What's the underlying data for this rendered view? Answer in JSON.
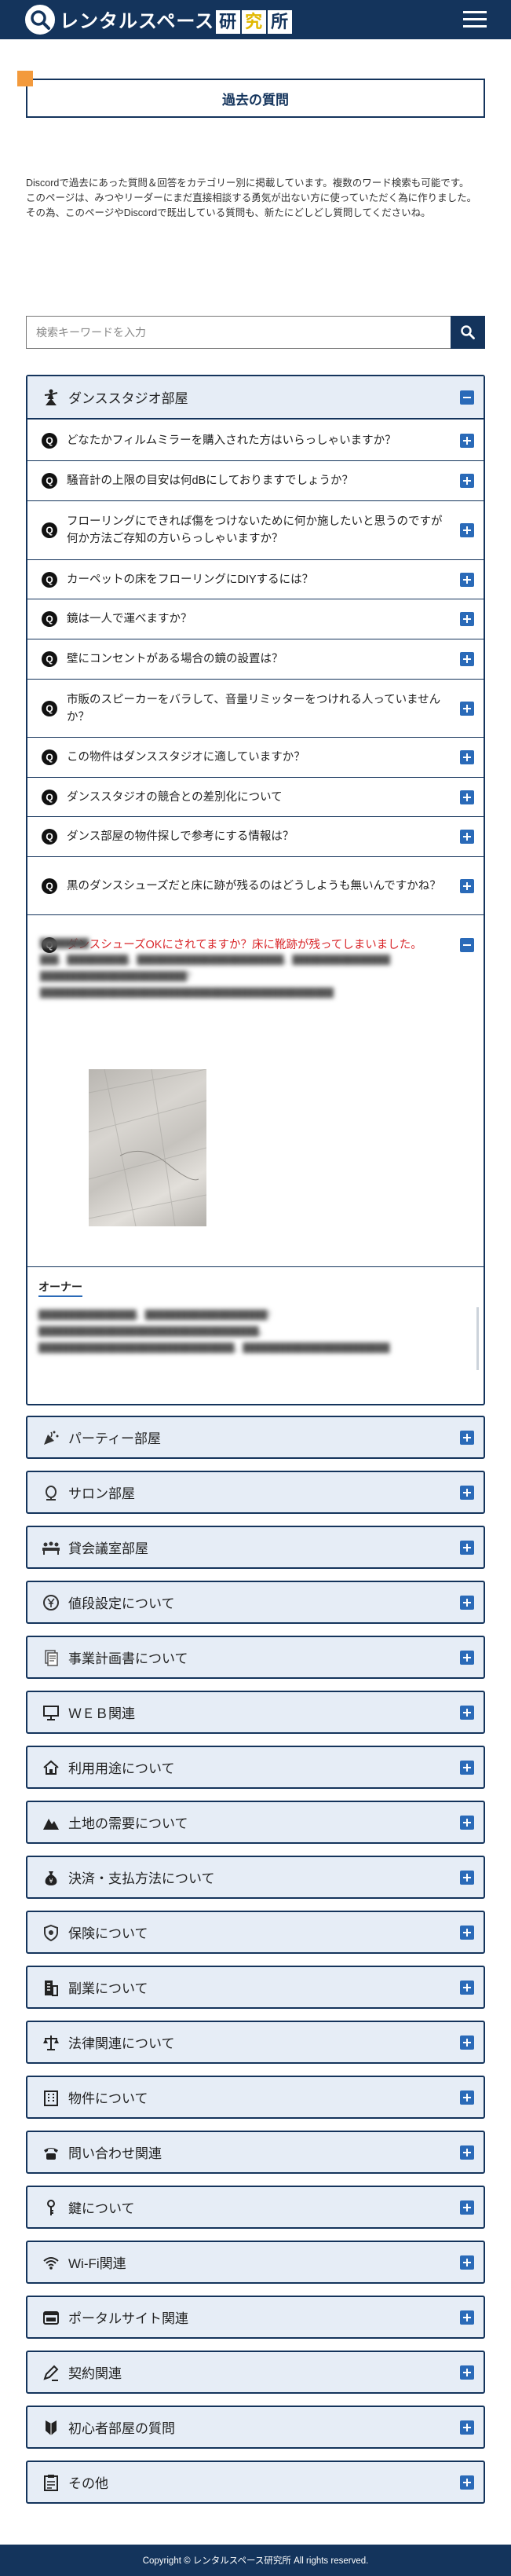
{
  "header": {
    "logo_text": "レンタルスペース",
    "logo_box_1": "研",
    "logo_box_2": "究",
    "logo_box_3": "所",
    "menu_icon": "hamburger-icon"
  },
  "page_title": "過去の質問",
  "intro_lines": [
    "Discordで過去にあった質問＆回答をカテゴリー別に掲載しています。複数のワード検索も可能です。",
    "このページは、みつやリーダーにまだ直接相談する勇気が出ない方に使っていただく為に作りました。",
    "その為、このページやDiscordで既出している質問も、新たにどしどし質問してくださいね。"
  ],
  "search": {
    "placeholder": "検索キーワードを入力",
    "icon": "search-icon"
  },
  "open_category": {
    "label": "ダンススタジオ部屋",
    "icon": "dancer-icon",
    "questions": [
      "どなたかフィルムミラーを購入された方はいらっしゃいますか？",
      "騒音計の上限の目安は何dBにしておりますでしょうか？",
      "フローリングにできれば傷をつけないために何か施したいと思うのですが何か方法ご存知の方いらっしゃいますか？",
      "カーペットの床をフローリングにDIYするには？",
      "鏡は一人で運べますか？",
      "壁にコンセントがある場合の鏡の設置は？",
      "市販のスピーカーをバラして、音量リミッターをつけれる人っていませんか？",
      "この物件はダンススタジオに適していますか？",
      "ダンススタジオの競合との差別化について",
      "ダンス部屋の物件探しで参考にする情報は？",
      "黒のダンスシューズだと床に跡が残るのはどうしようも無いんですかね？",
      "ダンスシューズOKにされてますか？床に靴跡が残ってしまいました。"
    ],
    "q_badge": "Q",
    "answer_owner_label": "オーナー"
  },
  "categories": [
    {
      "label": "パーティー部屋",
      "icon": "party-popper-icon"
    },
    {
      "label": "サロン部屋",
      "icon": "salon-mirror-icon"
    },
    {
      "label": "貸会議室部屋",
      "icon": "meeting-people-icon"
    },
    {
      "label": "値段設定について",
      "icon": "yen-coin-icon"
    },
    {
      "label": "事業計画書について",
      "icon": "document-icon"
    },
    {
      "label": "ＷＥＢ関連",
      "icon": "monitor-icon"
    },
    {
      "label": "利用用途について",
      "icon": "home-icon"
    },
    {
      "label": "土地の需要について",
      "icon": "mountain-icon"
    },
    {
      "label": "決済・支払方法について",
      "icon": "money-bag-icon"
    },
    {
      "label": "保険について",
      "icon": "shield-icon"
    },
    {
      "label": "副業について",
      "icon": "office-building-icon"
    },
    {
      "label": "法律関連について",
      "icon": "scales-icon"
    },
    {
      "label": "物件について",
      "icon": "building-icon"
    },
    {
      "label": "問い合わせ関連",
      "icon": "telephone-icon"
    },
    {
      "label": "鍵について",
      "icon": "key-icon"
    },
    {
      "label": "Wi-Fi関連",
      "icon": "wifi-icon"
    },
    {
      "label": "ポータルサイト関連",
      "icon": "browser-icon"
    },
    {
      "label": "契約関連",
      "icon": "pen-contract-icon"
    },
    {
      "label": "初心者部屋の質問",
      "icon": "beginner-mark-icon"
    },
    {
      "label": "その他",
      "icon": "clipboard-icon"
    }
  ],
  "footer": "Copyright © レンタルスペース研究所 All rights reserved."
}
